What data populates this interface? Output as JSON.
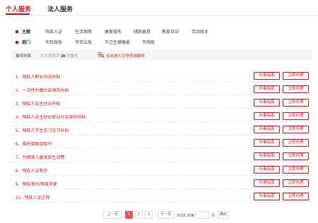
{
  "tabs": {
    "personal": "个人服务",
    "legal": "法人服务"
  },
  "filters": {
    "theme": {
      "label": "主题",
      "items": [
        "残疾人证",
        "生活保障",
        "康复服务",
        "辅助器具",
        "教育培训",
        "劳动就业"
      ]
    },
    "department": {
      "label": "部门",
      "items": [
        "市民政局",
        "市司法局",
        "市卫生健康委",
        "市残联"
      ]
    }
  },
  "results": {
    "label": "事项列表:",
    "count_prefix": "共为您找到",
    "count": "28",
    "count_suffix": "项服务",
    "guide_link": "点击进入引导查询服务"
  },
  "services": [
    {
      "title": "1、残疾人职业培训补贴"
    },
    {
      "title": "2、一次性补缴社会保险补贴"
    },
    {
      "title": "3、残疾人自主创业补贴"
    },
    {
      "title": "4、残疾人自主创业就业社会保险补贴"
    },
    {
      "title": "5、残疾人学生实习见习补贴"
    },
    {
      "title": "6、临时救助金给付"
    },
    {
      "title": "7、为困境儿童发放生活费"
    },
    {
      "title": "8、残疾人证新办"
    },
    {
      "title": "9、残疾类别/等级变更"
    },
    {
      "title": "10、残疾人证迁移"
    }
  ],
  "buttons": {
    "guide": "办事指南",
    "apply": "立即办理"
  },
  "pagination": {
    "prev": "上一页",
    "pages": [
      "1",
      "2",
      "3"
    ],
    "current": "1",
    "next": "下一页",
    "total": "共3页,",
    "goto": "到第",
    "page_unit": "页",
    "confirm": "确定"
  },
  "colors": {
    "accent": "#d0121b",
    "active_page": "#e9545b"
  }
}
